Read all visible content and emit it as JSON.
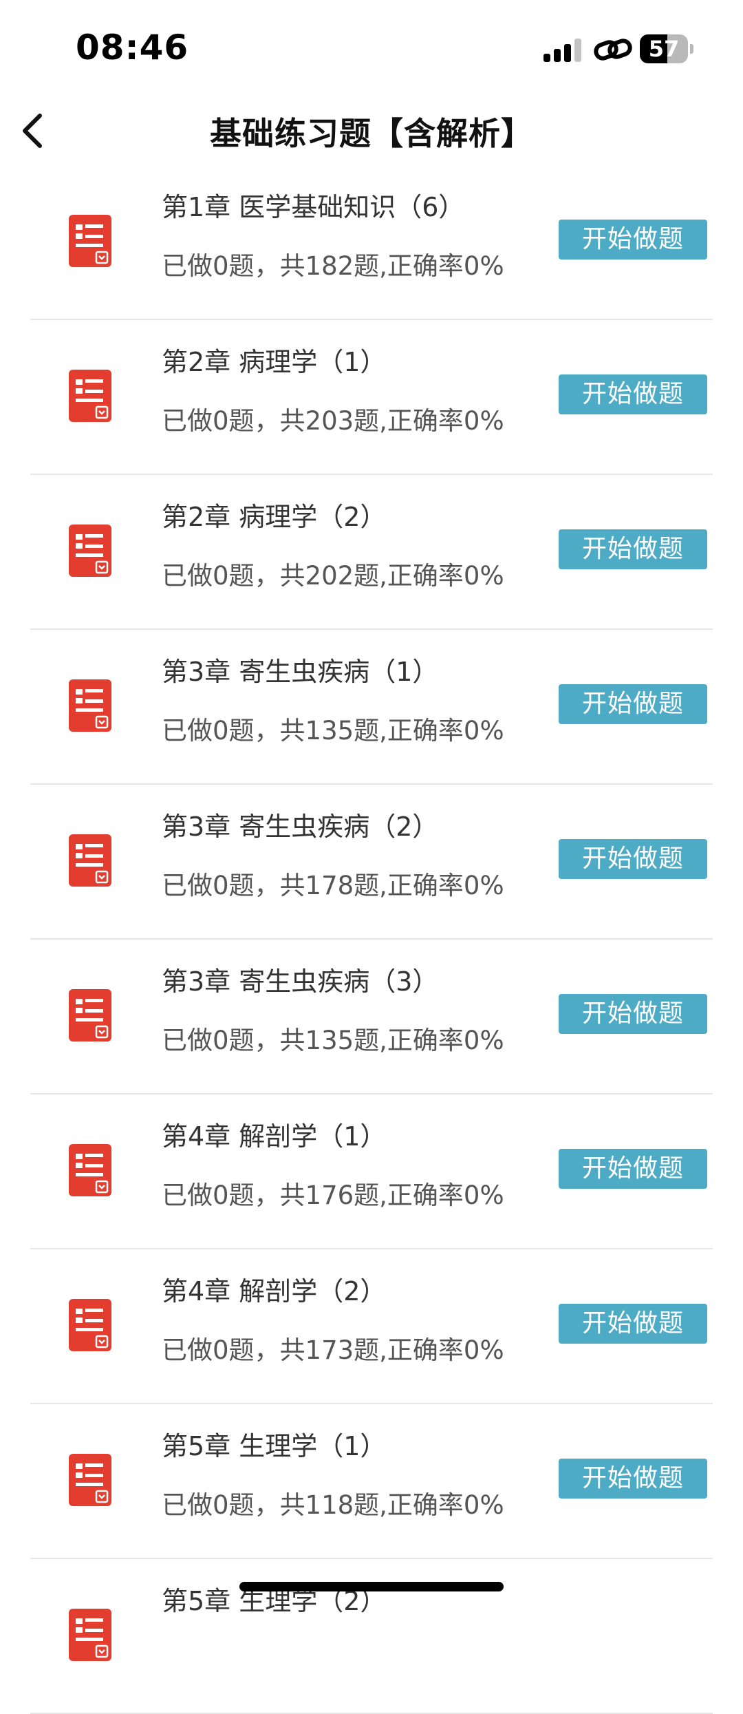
{
  "status_bar": {
    "time": "08:46",
    "battery_level": "57",
    "battery_percent": 57
  },
  "nav": {
    "title": "基础练习题【含解析】"
  },
  "colors": {
    "accent_button": "#4eabc6",
    "doc_icon": "#e23d2f"
  },
  "icons": {
    "back": "chevron-left-icon",
    "row": "document-list-icon",
    "signal": "cellular-signal-icon",
    "link": "link-icon",
    "battery": "battery-icon"
  },
  "chapters": [
    {
      "title": "第1章  医学基础知识（6）",
      "progress": "已做0题，共182题,正确率0%",
      "button": "开始做题"
    },
    {
      "title": "第2章  病理学（1）",
      "progress": "已做0题，共203题,正确率0%",
      "button": "开始做题"
    },
    {
      "title": "第2章  病理学（2）",
      "progress": "已做0题，共202题,正确率0%",
      "button": "开始做题"
    },
    {
      "title": "第3章  寄生虫疾病（1）",
      "progress": "已做0题，共135题,正确率0%",
      "button": "开始做题"
    },
    {
      "title": "第3章  寄生虫疾病（2）",
      "progress": "已做0题，共178题,正确率0%",
      "button": "开始做题"
    },
    {
      "title": "第3章  寄生虫疾病（3）",
      "progress": "已做0题，共135题,正确率0%",
      "button": "开始做题"
    },
    {
      "title": "第4章  解剖学（1）",
      "progress": "已做0题，共176题,正确率0%",
      "button": "开始做题"
    },
    {
      "title": "第4章  解剖学（2）",
      "progress": "已做0题，共173题,正确率0%",
      "button": "开始做题"
    },
    {
      "title": "第5章  生理学（1）",
      "progress": "已做0题，共118题,正确率0%",
      "button": "开始做题"
    },
    {
      "title": "第5章  生理学（2）",
      "progress": "",
      "button": ""
    }
  ]
}
